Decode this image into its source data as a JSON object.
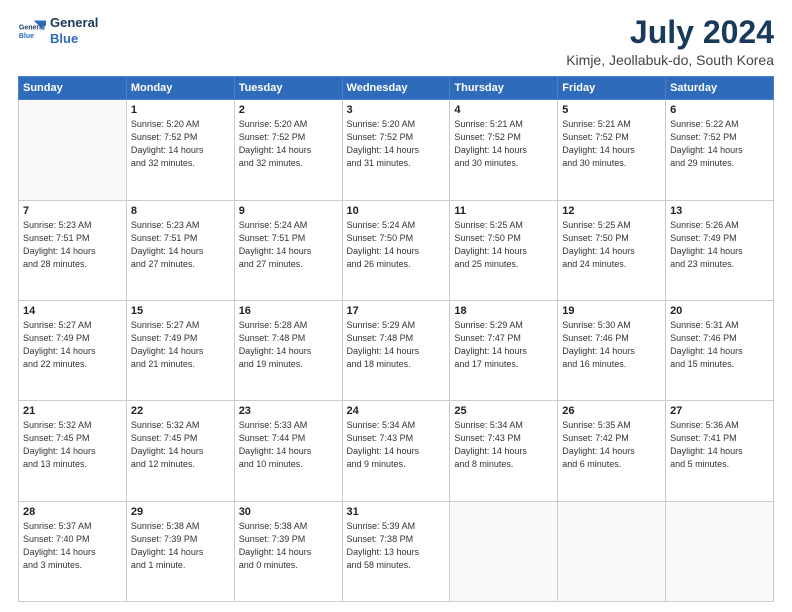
{
  "header": {
    "logo_line1": "General",
    "logo_line2": "Blue",
    "title": "July 2024",
    "subtitle": "Kimje, Jeollabuk-do, South Korea"
  },
  "calendar": {
    "days_of_week": [
      "Sunday",
      "Monday",
      "Tuesday",
      "Wednesday",
      "Thursday",
      "Friday",
      "Saturday"
    ],
    "weeks": [
      [
        {
          "day": "",
          "info": ""
        },
        {
          "day": "1",
          "info": "Sunrise: 5:20 AM\nSunset: 7:52 PM\nDaylight: 14 hours\nand 32 minutes."
        },
        {
          "day": "2",
          "info": "Sunrise: 5:20 AM\nSunset: 7:52 PM\nDaylight: 14 hours\nand 32 minutes."
        },
        {
          "day": "3",
          "info": "Sunrise: 5:20 AM\nSunset: 7:52 PM\nDaylight: 14 hours\nand 31 minutes."
        },
        {
          "day": "4",
          "info": "Sunrise: 5:21 AM\nSunset: 7:52 PM\nDaylight: 14 hours\nand 30 minutes."
        },
        {
          "day": "5",
          "info": "Sunrise: 5:21 AM\nSunset: 7:52 PM\nDaylight: 14 hours\nand 30 minutes."
        },
        {
          "day": "6",
          "info": "Sunrise: 5:22 AM\nSunset: 7:52 PM\nDaylight: 14 hours\nand 29 minutes."
        }
      ],
      [
        {
          "day": "7",
          "info": "Sunrise: 5:23 AM\nSunset: 7:51 PM\nDaylight: 14 hours\nand 28 minutes."
        },
        {
          "day": "8",
          "info": "Sunrise: 5:23 AM\nSunset: 7:51 PM\nDaylight: 14 hours\nand 27 minutes."
        },
        {
          "day": "9",
          "info": "Sunrise: 5:24 AM\nSunset: 7:51 PM\nDaylight: 14 hours\nand 27 minutes."
        },
        {
          "day": "10",
          "info": "Sunrise: 5:24 AM\nSunset: 7:50 PM\nDaylight: 14 hours\nand 26 minutes."
        },
        {
          "day": "11",
          "info": "Sunrise: 5:25 AM\nSunset: 7:50 PM\nDaylight: 14 hours\nand 25 minutes."
        },
        {
          "day": "12",
          "info": "Sunrise: 5:25 AM\nSunset: 7:50 PM\nDaylight: 14 hours\nand 24 minutes."
        },
        {
          "day": "13",
          "info": "Sunrise: 5:26 AM\nSunset: 7:49 PM\nDaylight: 14 hours\nand 23 minutes."
        }
      ],
      [
        {
          "day": "14",
          "info": "Sunrise: 5:27 AM\nSunset: 7:49 PM\nDaylight: 14 hours\nand 22 minutes."
        },
        {
          "day": "15",
          "info": "Sunrise: 5:27 AM\nSunset: 7:49 PM\nDaylight: 14 hours\nand 21 minutes."
        },
        {
          "day": "16",
          "info": "Sunrise: 5:28 AM\nSunset: 7:48 PM\nDaylight: 14 hours\nand 19 minutes."
        },
        {
          "day": "17",
          "info": "Sunrise: 5:29 AM\nSunset: 7:48 PM\nDaylight: 14 hours\nand 18 minutes."
        },
        {
          "day": "18",
          "info": "Sunrise: 5:29 AM\nSunset: 7:47 PM\nDaylight: 14 hours\nand 17 minutes."
        },
        {
          "day": "19",
          "info": "Sunrise: 5:30 AM\nSunset: 7:46 PM\nDaylight: 14 hours\nand 16 minutes."
        },
        {
          "day": "20",
          "info": "Sunrise: 5:31 AM\nSunset: 7:46 PM\nDaylight: 14 hours\nand 15 minutes."
        }
      ],
      [
        {
          "day": "21",
          "info": "Sunrise: 5:32 AM\nSunset: 7:45 PM\nDaylight: 14 hours\nand 13 minutes."
        },
        {
          "day": "22",
          "info": "Sunrise: 5:32 AM\nSunset: 7:45 PM\nDaylight: 14 hours\nand 12 minutes."
        },
        {
          "day": "23",
          "info": "Sunrise: 5:33 AM\nSunset: 7:44 PM\nDaylight: 14 hours\nand 10 minutes."
        },
        {
          "day": "24",
          "info": "Sunrise: 5:34 AM\nSunset: 7:43 PM\nDaylight: 14 hours\nand 9 minutes."
        },
        {
          "day": "25",
          "info": "Sunrise: 5:34 AM\nSunset: 7:43 PM\nDaylight: 14 hours\nand 8 minutes."
        },
        {
          "day": "26",
          "info": "Sunrise: 5:35 AM\nSunset: 7:42 PM\nDaylight: 14 hours\nand 6 minutes."
        },
        {
          "day": "27",
          "info": "Sunrise: 5:36 AM\nSunset: 7:41 PM\nDaylight: 14 hours\nand 5 minutes."
        }
      ],
      [
        {
          "day": "28",
          "info": "Sunrise: 5:37 AM\nSunset: 7:40 PM\nDaylight: 14 hours\nand 3 minutes."
        },
        {
          "day": "29",
          "info": "Sunrise: 5:38 AM\nSunset: 7:39 PM\nDaylight: 14 hours\nand 1 minute."
        },
        {
          "day": "30",
          "info": "Sunrise: 5:38 AM\nSunset: 7:39 PM\nDaylight: 14 hours\nand 0 minutes."
        },
        {
          "day": "31",
          "info": "Sunrise: 5:39 AM\nSunset: 7:38 PM\nDaylight: 13 hours\nand 58 minutes."
        },
        {
          "day": "",
          "info": ""
        },
        {
          "day": "",
          "info": ""
        },
        {
          "day": "",
          "info": ""
        }
      ]
    ]
  }
}
